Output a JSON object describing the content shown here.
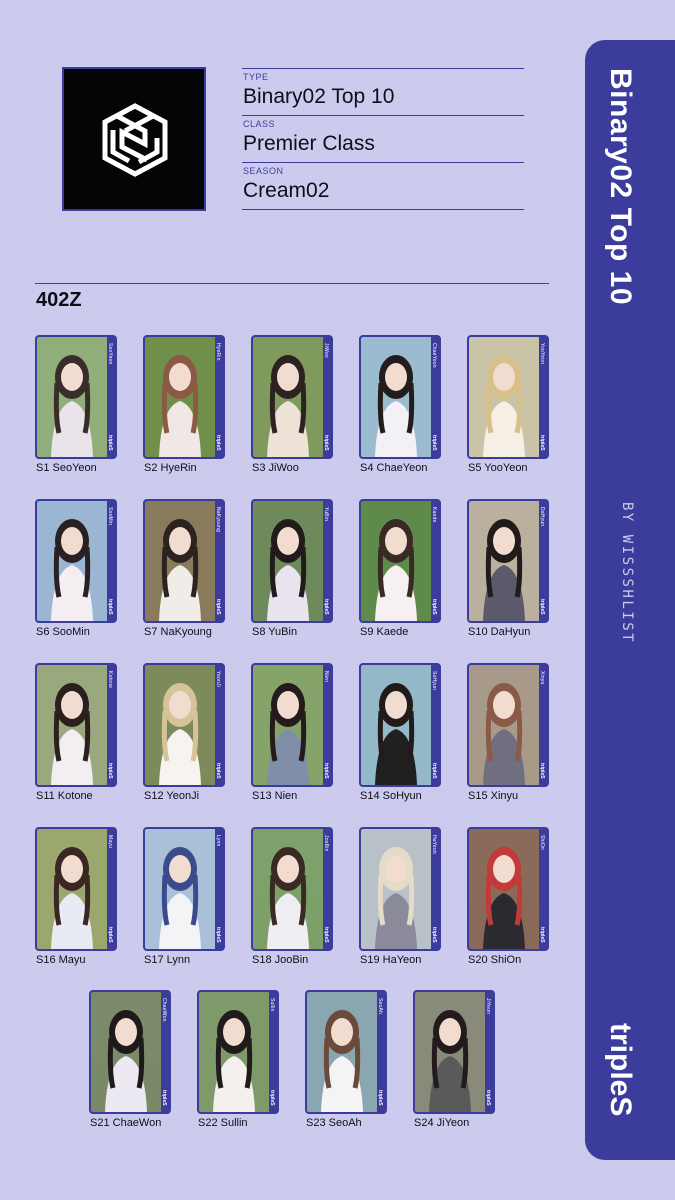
{
  "header": {
    "logo_icon": "tripleS-cube-logo-icon",
    "type_label": "TYPE",
    "type_value": "Binary02 Top 10",
    "class_label": "CLASS",
    "class_value": "Premier Class",
    "season_label": "SEASON",
    "season_value": "Cream02"
  },
  "section": {
    "title": "402Z"
  },
  "card_brand": "tripleS",
  "cards": [
    {
      "label": "S1 SeoYeon",
      "strip": "SeoYeon"
    },
    {
      "label": "S2 HyeRin",
      "strip": "HyeRin"
    },
    {
      "label": "S3 JiWoo",
      "strip": "JiWoo"
    },
    {
      "label": "S4 ChaeYeon",
      "strip": "ChaeYeon"
    },
    {
      "label": "S5 YooYeon",
      "strip": "YooYeon"
    },
    {
      "label": "S6 SooMin",
      "strip": "SooMin"
    },
    {
      "label": "S7 NaKyoung",
      "strip": "NaKyoung"
    },
    {
      "label": "S8 YuBin",
      "strip": "YuBin"
    },
    {
      "label": "S9 Kaede",
      "strip": "Kaede"
    },
    {
      "label": "S10 DaHyun",
      "strip": "DaHyun"
    },
    {
      "label": "S11 Kotone",
      "strip": "Kotone"
    },
    {
      "label": "S12 YeonJi",
      "strip": "YeonJi"
    },
    {
      "label": "S13 Nien",
      "strip": "Nien"
    },
    {
      "label": "S14 SoHyun",
      "strip": "SoHyun"
    },
    {
      "label": "S15 Xinyu",
      "strip": "Xinyu"
    },
    {
      "label": "S16 Mayu",
      "strip": "Mayu"
    },
    {
      "label": "S17 Lynn",
      "strip": "Lynn"
    },
    {
      "label": "S18 JooBin",
      "strip": "JooBin"
    },
    {
      "label": "S19 HaYeon",
      "strip": "HaYeon"
    },
    {
      "label": "S20 ShiOn",
      "strip": "ShiOn"
    },
    {
      "label": "S21 ChaeWon",
      "strip": "ChaeWon"
    },
    {
      "label": "S22 Sullin",
      "strip": "Sullin"
    },
    {
      "label": "S23 SeoAh",
      "strip": "SeoAh"
    },
    {
      "label": "S24 JiYeon",
      "strip": "JiYeon"
    }
  ],
  "side": {
    "title": "Binary02 Top 10",
    "credit": "BY WISSSHLIST",
    "brand": "tripleS"
  },
  "colors": {
    "background": "#cccbee",
    "accent": "#3c3c9c",
    "text": "#0e0e1a"
  }
}
